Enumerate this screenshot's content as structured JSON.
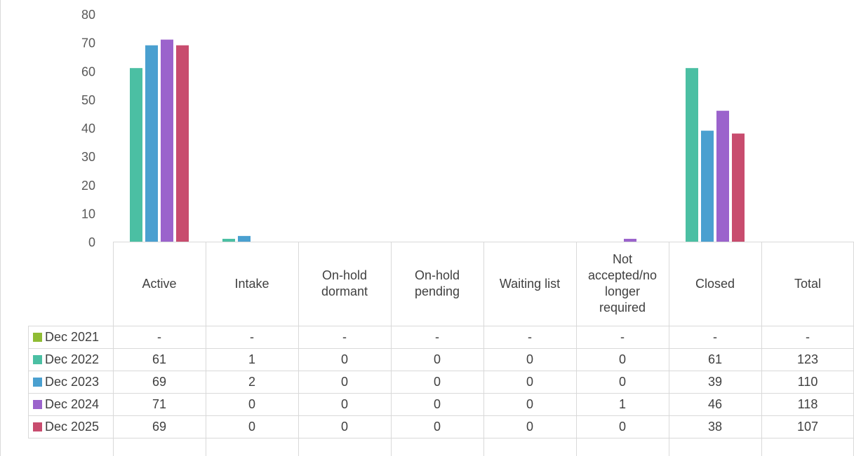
{
  "chart_data": {
    "type": "bar",
    "title": "",
    "ylim": [
      0,
      80
    ],
    "yticks": [
      0,
      10,
      20,
      30,
      40,
      50,
      60,
      70,
      80
    ],
    "categories": [
      "Active",
      "Intake",
      "On-hold dormant",
      "On-hold pending",
      "Waiting list",
      "Not accepted/no longer required",
      "Closed",
      "Total"
    ],
    "category_lines": [
      [
        "Active"
      ],
      [
        "Intake"
      ],
      [
        "On-hold",
        "dormant"
      ],
      [
        "On-hold",
        "pending"
      ],
      [
        "Waiting list"
      ],
      [
        "Not",
        "accepted/no",
        "longer",
        "required"
      ],
      [
        "Closed"
      ],
      [
        "Total"
      ]
    ],
    "series": [
      {
        "name": "Dec 2021",
        "color": "#8fbc34",
        "values": [
          null,
          null,
          null,
          null,
          null,
          null,
          null,
          null
        ],
        "display": [
          "-",
          "-",
          "-",
          "-",
          "-",
          "-",
          "-",
          "-"
        ]
      },
      {
        "name": "Dec 2022",
        "color": "#4bbfa3",
        "values": [
          61,
          1,
          0,
          0,
          0,
          0,
          61,
          123
        ],
        "display": [
          "61",
          "1",
          "0",
          "0",
          "0",
          "0",
          "61",
          "123"
        ]
      },
      {
        "name": "Dec 2023",
        "color": "#4aa0d0",
        "values": [
          69,
          2,
          0,
          0,
          0,
          0,
          39,
          110
        ],
        "display": [
          "69",
          "2",
          "0",
          "0",
          "0",
          "0",
          "39",
          "110"
        ]
      },
      {
        "name": "Dec 2024",
        "color": "#9b63cc",
        "values": [
          71,
          0,
          0,
          0,
          0,
          1,
          46,
          118
        ],
        "display": [
          "71",
          "0",
          "0",
          "0",
          "0",
          "1",
          "46",
          "118"
        ]
      },
      {
        "name": "Dec 2025",
        "color": "#c84c6e",
        "values": [
          69,
          0,
          0,
          0,
          0,
          0,
          38,
          107
        ],
        "display": [
          "69",
          "0",
          "0",
          "0",
          "0",
          "0",
          "38",
          "107"
        ]
      }
    ],
    "grid": false,
    "legend": "data-table"
  }
}
